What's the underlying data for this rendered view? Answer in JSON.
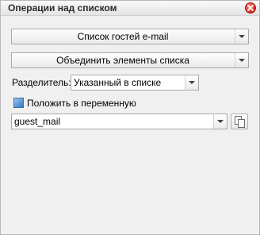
{
  "window": {
    "title": "Операции над списком"
  },
  "list_select": {
    "value": "Список гостей e-mail"
  },
  "operation_select": {
    "value": "Объединить элементы списка"
  },
  "separator": {
    "label": "Разделитель:",
    "value": "Указанный в списке"
  },
  "save_to_variable": {
    "label": "Положить в переменную",
    "checked": true
  },
  "variable_select": {
    "value": "guest_mail"
  },
  "icons": {
    "close": "close-icon",
    "copy": "copy-icon",
    "dropdown": "chevron-down-icon",
    "checkbox": "checkbox-icon"
  },
  "colors": {
    "close_button": "#d42a20",
    "checkbox": "#2f78c4"
  }
}
